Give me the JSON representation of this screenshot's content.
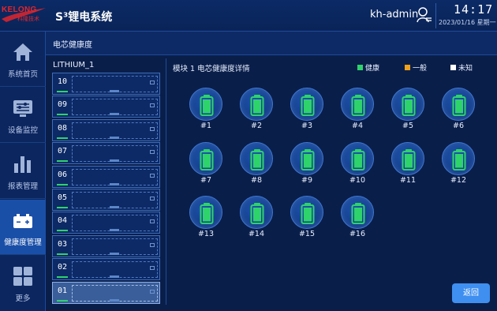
{
  "header": {
    "logo_text": "KELONG",
    "logo_sub": "科隆技术",
    "app_title": "S³锂电系统",
    "user": "kh-admin",
    "time": "14:17",
    "date": "2023/01/16 星期一"
  },
  "sidebar": {
    "items": [
      {
        "label": "系统首页",
        "icon": "home-icon",
        "active": false
      },
      {
        "label": "设备监控",
        "icon": "monitor-icon",
        "active": false
      },
      {
        "label": "报表管理",
        "icon": "bar-chart-icon",
        "active": false
      },
      {
        "label": "健康度管理",
        "icon": "battery-health-icon",
        "active": true
      },
      {
        "label": "更多",
        "icon": "grid-icon",
        "active": false
      }
    ]
  },
  "page": {
    "title": "电芯健康度"
  },
  "rack": {
    "title": "LITHIUM_1",
    "modules": [
      "10",
      "09",
      "08",
      "07",
      "06",
      "05",
      "04",
      "03",
      "02",
      "01"
    ],
    "selected": "01"
  },
  "detail": {
    "title": "模块 1 电芯健康度详情",
    "legend": [
      {
        "label": "健康",
        "color": "#2ed36b"
      },
      {
        "label": "一般",
        "color": "#f0a21a"
      },
      {
        "label": "未知",
        "color": "#ffffff"
      }
    ],
    "cells": [
      {
        "label": "#1",
        "status": "healthy"
      },
      {
        "label": "#2",
        "status": "healthy"
      },
      {
        "label": "#3",
        "status": "healthy"
      },
      {
        "label": "#4",
        "status": "healthy"
      },
      {
        "label": "#5",
        "status": "healthy"
      },
      {
        "label": "#6",
        "status": "healthy"
      },
      {
        "label": "#7",
        "status": "healthy"
      },
      {
        "label": "#8",
        "status": "healthy"
      },
      {
        "label": "#9",
        "status": "healthy"
      },
      {
        "label": "#10",
        "status": "healthy"
      },
      {
        "label": "#11",
        "status": "healthy"
      },
      {
        "label": "#12",
        "status": "healthy"
      },
      {
        "label": "#13",
        "status": "healthy"
      },
      {
        "label": "#14",
        "status": "healthy"
      },
      {
        "label": "#15",
        "status": "healthy"
      },
      {
        "label": "#16",
        "status": "healthy"
      }
    ]
  },
  "actions": {
    "back_label": "返回"
  },
  "colors": {
    "accent": "#3f8ff0",
    "healthy": "#2ed36b"
  }
}
